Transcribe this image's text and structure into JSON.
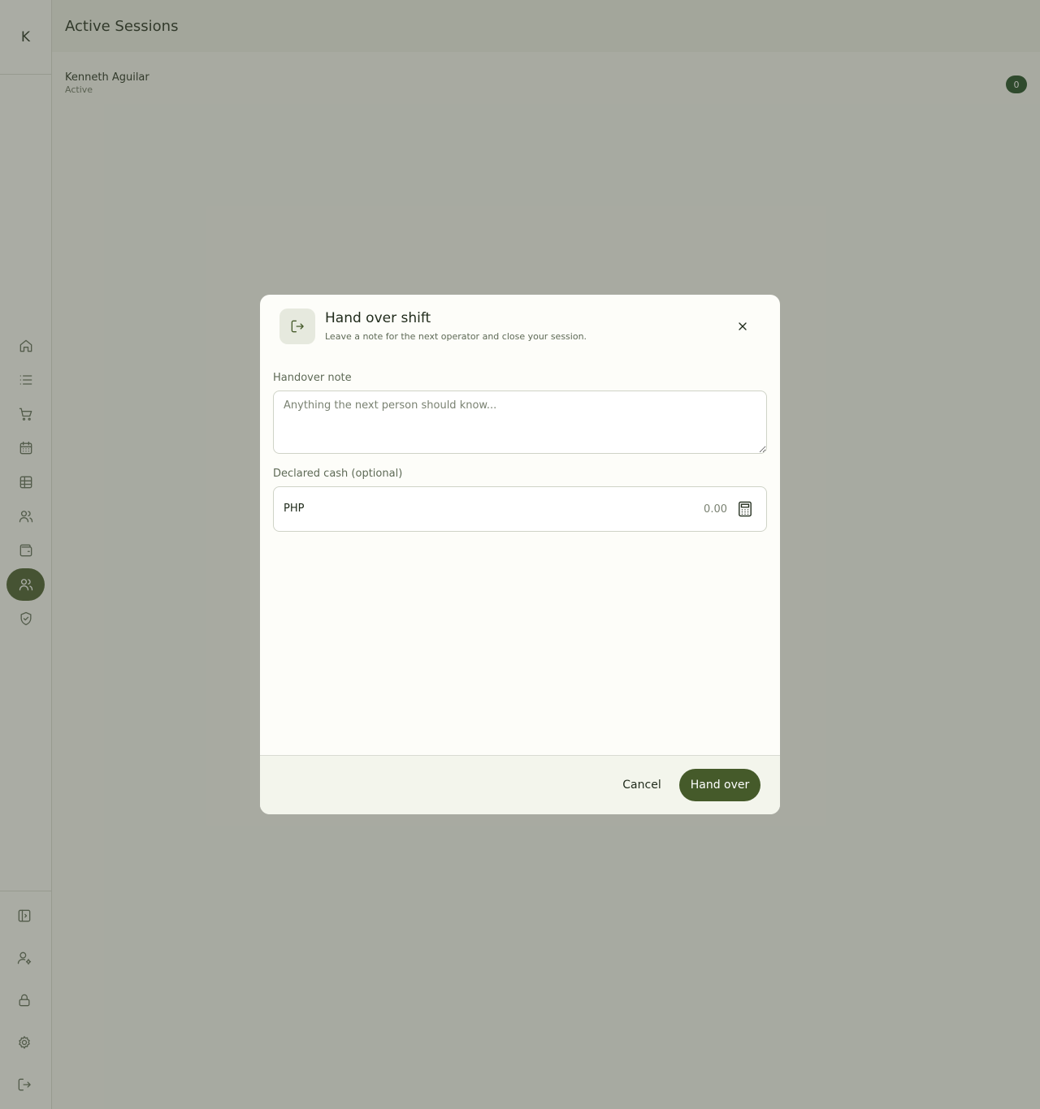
{
  "app": {
    "logo_letter": "K",
    "page_title": "Active Sessions"
  },
  "sidebar": {
    "nav_items": [
      {
        "name": "home",
        "icon": "home-icon",
        "active": false
      },
      {
        "name": "list",
        "icon": "list-icon",
        "active": false
      },
      {
        "name": "cart",
        "icon": "cart-icon",
        "active": false
      },
      {
        "name": "calendar",
        "icon": "calendar-icon",
        "active": false
      },
      {
        "name": "table",
        "icon": "table-icon",
        "active": false
      },
      {
        "name": "customers",
        "icon": "users-icon",
        "active": false
      },
      {
        "name": "wallet",
        "icon": "wallet-icon",
        "active": false
      },
      {
        "name": "sessions",
        "icon": "users-icon",
        "active": true
      },
      {
        "name": "security",
        "icon": "shield-check-icon",
        "active": false
      }
    ],
    "bottom_items": [
      {
        "name": "collapse",
        "icon": "panel-toggle-icon"
      },
      {
        "name": "account",
        "icon": "user-gear-icon"
      },
      {
        "name": "lock",
        "icon": "lock-icon"
      },
      {
        "name": "settings",
        "icon": "gear-icon"
      },
      {
        "name": "logout",
        "icon": "logout-icon"
      }
    ]
  },
  "sessions": [
    {
      "name": "Kenneth Aguilar",
      "status": "Active",
      "count": "0"
    }
  ],
  "modal": {
    "icon": "logout-icon",
    "title": "Hand over shift",
    "subtitle": "Leave a note for the next operator and close your session.",
    "close_icon": "close-icon",
    "note_label": "Handover note",
    "note_placeholder": "Anything the next person should know...",
    "cash_label": "Declared cash (optional)",
    "currency": "PHP",
    "cash_placeholder": "0.00",
    "calculator_icon": "calculator-icon",
    "cancel_label": "Cancel",
    "submit_label": "Hand over"
  },
  "colors": {
    "accent": "#455a2a",
    "badge": "#1d4a1f",
    "background": "#f7f8f2"
  }
}
